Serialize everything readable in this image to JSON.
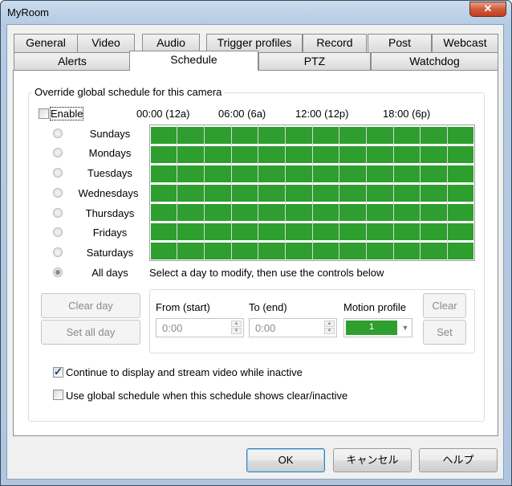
{
  "window": {
    "title": "MyRoom",
    "close_glyph": "✕"
  },
  "tabs": {
    "row1": [
      "General",
      "Video",
      "Audio",
      "Trigger profiles",
      "Record",
      "Post",
      "Webcast"
    ],
    "row2": [
      "Alerts",
      "Schedule",
      "PTZ",
      "Watchdog"
    ],
    "active": "Schedule"
  },
  "schedule": {
    "group_title": "Override global schedule for this camera",
    "enable_label": "Enable",
    "enable_checked": false,
    "hour_labels": [
      "00:00 (12a)",
      "06:00 (6a)",
      "12:00 (12p)",
      "18:00 (6p)"
    ],
    "days": [
      "Sundays",
      "Mondays",
      "Tuesdays",
      "Wednesdays",
      "Thursdays",
      "Fridays",
      "Saturdays",
      "All days"
    ],
    "selected_day": "All days",
    "hint": "Select a day to modify, then use the controls below",
    "fill_color": "#2e9e2e",
    "clear_day_label": "Clear day",
    "set_all_day_label": "Set all day",
    "from_label": "From (start)",
    "to_label": "To (end)",
    "motion_profile_label": "Motion profile",
    "from_value": "0:00",
    "to_value": "0:00",
    "motion_profile_value": "1",
    "clear_label": "Clear",
    "set_label": "Set",
    "continue_label": "Continue to display and stream video while inactive",
    "continue_checked": true,
    "global_label": "Use global schedule when this schedule shows clear/inactive",
    "global_checked": false
  },
  "footer": {
    "ok_label": "OK",
    "cancel_label": "キャンセル",
    "help_label": "ヘルプ"
  }
}
